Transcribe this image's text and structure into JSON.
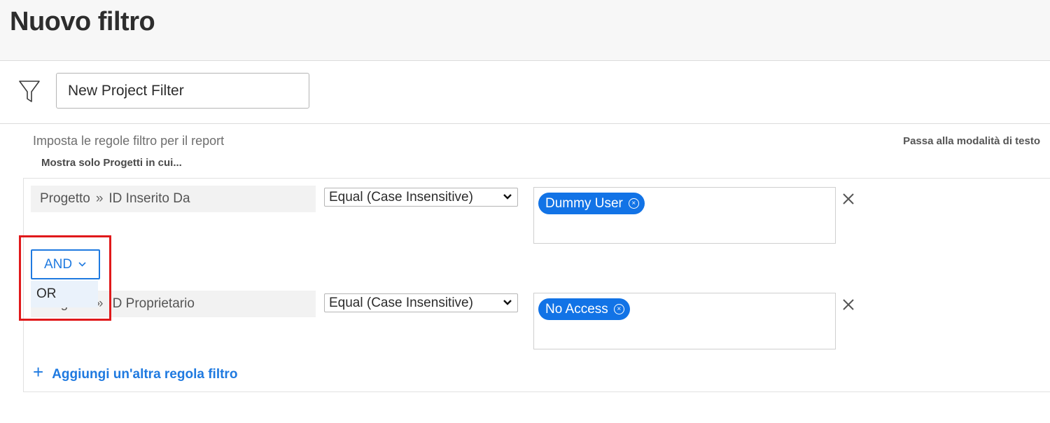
{
  "header": {
    "title": "Nuovo filtro"
  },
  "filter": {
    "name_value": "New Project Filter"
  },
  "rules_section": {
    "subtitle": "Imposta le regole filtro per il report",
    "text_mode_link": "Passa alla modalità di testo",
    "show_only_label": "Mostra solo Progetti in cui..."
  },
  "rules": [
    {
      "object": "Progetto",
      "separator": "»",
      "field": "ID Inserito Da",
      "operator": "Equal (Case Insensitive)",
      "value_chip": "Dummy User"
    },
    {
      "object": "Progetto",
      "separator": "»",
      "field": "ID Proprietario",
      "operator": "Equal (Case Insensitive)",
      "value_chip": "No Access"
    }
  ],
  "conjunction": {
    "selected": "AND",
    "options": [
      "OR"
    ]
  },
  "add_rule_label": "Aggiungi un'altra regola filtro",
  "icons": {
    "filter": "funnel-icon",
    "caret": "chevron-down-icon",
    "remove": "close-icon",
    "chip_remove": "circle-x-icon",
    "add": "plus-icon"
  },
  "colors": {
    "accent": "#1f7ae0",
    "chip": "#1273e6",
    "highlight": "#e0191b",
    "header_bg": "#f7f7f7"
  }
}
